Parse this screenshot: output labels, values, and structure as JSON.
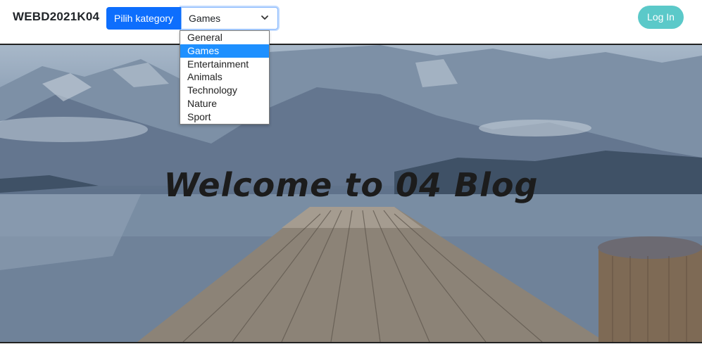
{
  "navbar": {
    "brand": "WEBD2021K04",
    "category_label": "Pilih kategory",
    "category_selected": "Games",
    "category_options": [
      "General",
      "Games",
      "Entertainment",
      "Animals",
      "Technology",
      "Nature",
      "Sport"
    ],
    "login_label": "Log In"
  },
  "hero": {
    "title": "Welcome to 04 Blog"
  },
  "colors": {
    "primary": "#0d6efd",
    "login": "#5bc9c9",
    "option_highlight": "#1e90ff"
  },
  "icons": {
    "select_chevron": "chevron-down-icon"
  }
}
